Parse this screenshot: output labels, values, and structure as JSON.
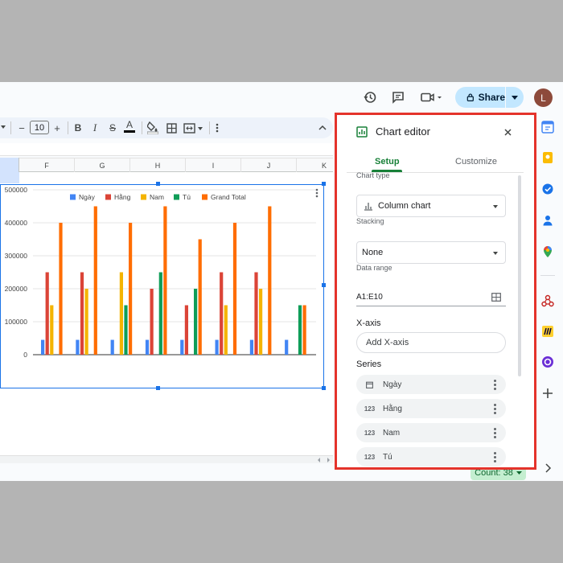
{
  "topbar": {
    "share_label": "Share",
    "avatar_initial": "L"
  },
  "toolbar": {
    "font_size": "10",
    "minus": "−",
    "plus": "+",
    "bold": "B",
    "italic": "I",
    "strike": "S",
    "text_color": "A"
  },
  "columns": [
    "F",
    "G",
    "H",
    "I",
    "J",
    "K"
  ],
  "chart_data": {
    "type": "bar",
    "legend": [
      "Ngày",
      "Hằng",
      "Nam",
      "Tú",
      "Grand Total"
    ],
    "legend_position": "top",
    "series_colors": [
      "#4285f4",
      "#db4437",
      "#f4b400",
      "#0f9d58",
      "#ff6d01"
    ],
    "y_ticks": [
      "500000",
      "400000",
      "300000",
      "200000",
      "100000",
      "0"
    ],
    "ylim": [
      0,
      500000
    ],
    "groups": [
      [
        45000,
        250000,
        150000,
        0,
        400000
      ],
      [
        45000,
        250000,
        200000,
        0,
        450000
      ],
      [
        45000,
        0,
        250000,
        150000,
        400000
      ],
      [
        45000,
        200000,
        0,
        250000,
        450000
      ],
      [
        45000,
        150000,
        0,
        200000,
        350000
      ],
      [
        45000,
        250000,
        150000,
        0,
        400000
      ],
      [
        45000,
        250000,
        200000,
        0,
        450000
      ],
      [
        45000,
        0,
        0,
        150000,
        150000
      ]
    ]
  },
  "editor": {
    "title": "Chart editor",
    "tab_setup": "Setup",
    "tab_customize": "Customize",
    "chart_type_label": "Chart type",
    "chart_type_value": "Column chart",
    "stacking_label": "Stacking",
    "stacking_value": "None",
    "data_range_label": "Data range",
    "data_range_value": "A1:E10",
    "x_axis_title": "X-axis",
    "add_x_axis": "Add X-axis",
    "series_title": "Series",
    "series": [
      {
        "name": "Ngày",
        "icon": "calendar-icon"
      },
      {
        "name": "Hằng",
        "icon": "123"
      },
      {
        "name": "Nam",
        "icon": "123"
      },
      {
        "name": "Tú",
        "icon": "123"
      }
    ]
  },
  "status": {
    "count": "Count: 38"
  },
  "colors": {
    "accent_green": "#188038",
    "share_bg": "#c2e7ff",
    "selection_blue": "#1a73e8",
    "highlight_red": "#e4332b"
  }
}
